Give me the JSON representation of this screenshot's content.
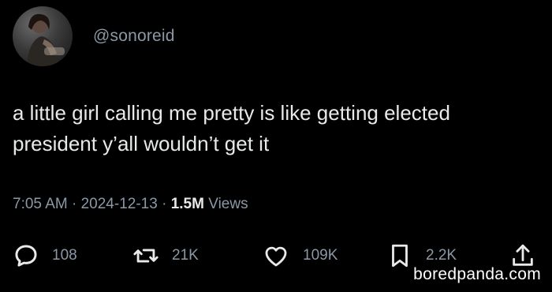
{
  "author": {
    "handle": "@sonoreid",
    "avatar_icon": "profile-photo"
  },
  "tweet": {
    "text": "a little girl calling me pretty is like getting elected president y’all wouldn’t get it"
  },
  "meta": {
    "time": "7:05 AM",
    "separator": "·",
    "date": "2024-12-13",
    "views_count": "1.5M",
    "views_label": "Views"
  },
  "actions": {
    "replies": {
      "icon": "reply-icon",
      "count": "108"
    },
    "reposts": {
      "icon": "repost-icon",
      "count": "21K"
    },
    "likes": {
      "icon": "heart-icon",
      "count": "109K"
    },
    "bookmarks": {
      "icon": "bookmark-icon",
      "count": "2.2K"
    },
    "share": {
      "icon": "share-icon"
    }
  },
  "watermark": "boredpanda.com",
  "colors": {
    "background": "#000000",
    "text": "#e7e9ea",
    "secondary": "#8b98a5"
  }
}
